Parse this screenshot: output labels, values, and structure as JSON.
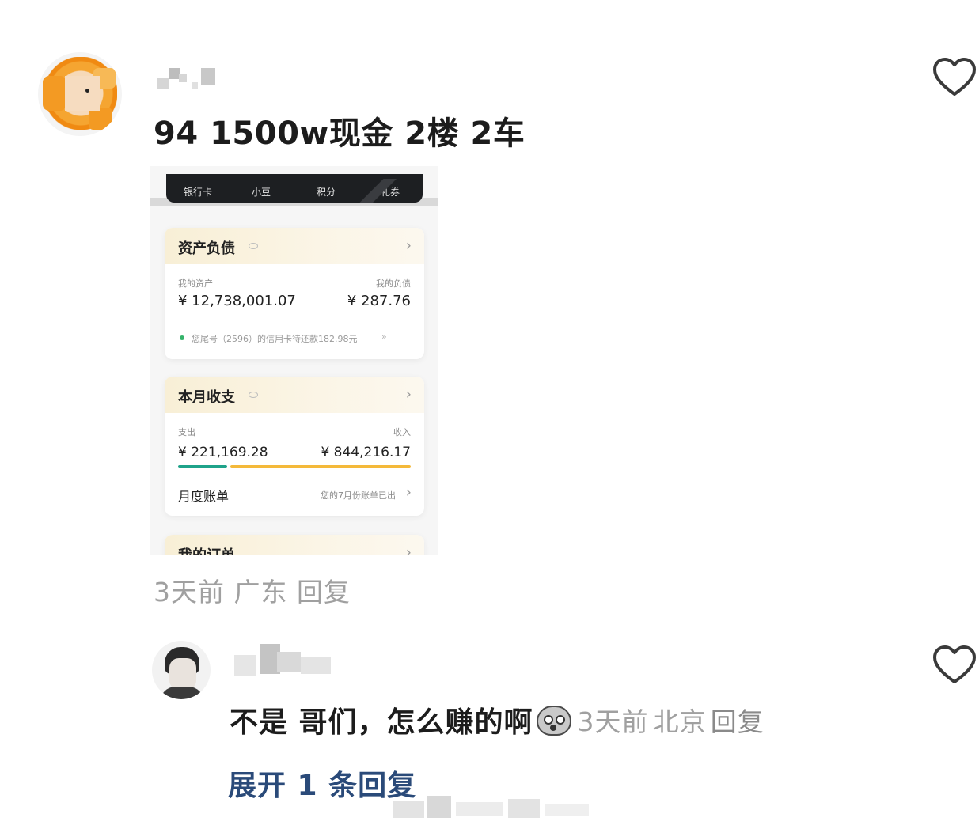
{
  "comments": [
    {
      "text": "94 1500w现金 2楼 2车",
      "time": "3天前",
      "location": "广东",
      "reply": "回复",
      "image": {
        "tabs": [
          "银行卡",
          "小豆",
          "积分",
          "礼券"
        ],
        "assets_card": {
          "title": "资产负债",
          "my_assets_label": "我的资产",
          "my_assets_value": "¥ 12,738,001.07",
          "my_debt_label": "我的负债",
          "my_debt_value": "¥ 287.76",
          "notice": "您尾号（2596）的信用卡待还款182.98元",
          "notice_chevron": "»"
        },
        "monthly_card": {
          "title": "本月收支",
          "expense_label": "支出",
          "expense_value": "¥ 221,169.28",
          "income_label": "收入",
          "income_value": "¥ 844,216.17",
          "expense_share": 0.21,
          "bill_label": "月度账单",
          "bill_note": "您的7月份账单已出"
        },
        "orders_card": {
          "title": "我的订单"
        },
        "chevron": "›"
      }
    },
    {
      "text": "不是 哥们，怎么赚的啊",
      "emoji": "shocked-face-emoji",
      "time": "3天前",
      "location": "北京",
      "reply": "回复"
    }
  ],
  "expand_replies": "展开 1 条回复",
  "icons": {
    "like": "heart-outline-icon",
    "eye": "eye-icon",
    "chevron": "chevron-right-icon"
  },
  "colors": {
    "reply_link": "#2a4a79",
    "meta_text": "#a0a0a0",
    "expense_bar": "#1fa38a",
    "income_bar": "#f4b93a"
  }
}
